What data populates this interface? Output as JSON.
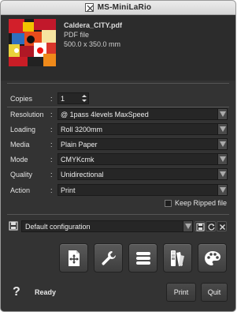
{
  "window": {
    "title": "MS-MiniLaRio"
  },
  "file": {
    "name": "Caldera_CITY.pdf",
    "type": "PDF file",
    "size": "500.0 x 350.0 mm"
  },
  "settings": {
    "copies": {
      "label": "Copies",
      "value": "1"
    },
    "resolution": {
      "label": "Resolution",
      "value": "@ 1pass 4levels MaxSpeed"
    },
    "loading": {
      "label": "Loading",
      "value": "Roll 3200mm"
    },
    "media": {
      "label": "Media",
      "value": "Plain Paper"
    },
    "mode": {
      "label": "Mode",
      "value": "CMYKcmk"
    },
    "quality": {
      "label": "Quality",
      "value": "Unidirectional"
    },
    "action": {
      "label": "Action",
      "value": "Print"
    },
    "colon": ":"
  },
  "keep_ripped": {
    "label": "Keep Ripped file",
    "checked": false
  },
  "configuration": {
    "value": "Default configuration"
  },
  "toolbar": {
    "icons": [
      "layout-icon",
      "wrench-icon",
      "list-icon",
      "color-swatch-icon",
      "palette-icon"
    ]
  },
  "footer": {
    "help": "?",
    "status": "Ready",
    "print_label": "Print",
    "quit_label": "Quit"
  },
  "colors": {
    "panel": "#333333",
    "field": "#262626",
    "accent_red": "#e02020"
  }
}
